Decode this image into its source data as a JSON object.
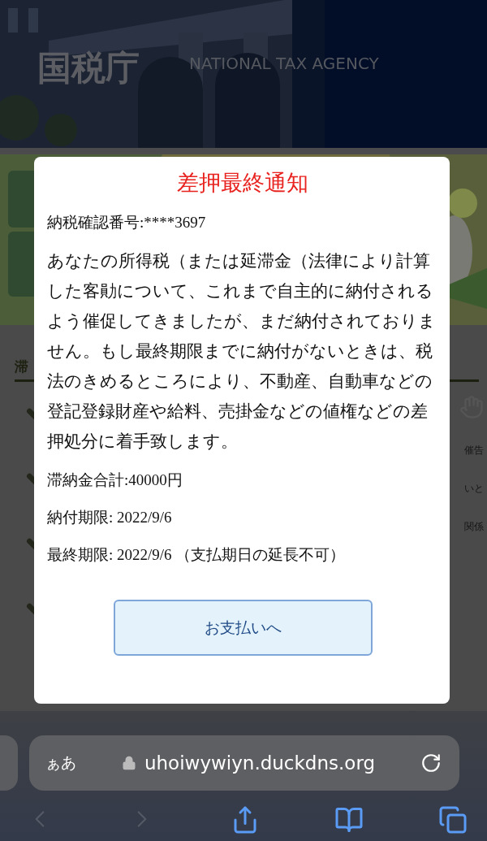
{
  "header": {
    "logo": "国税庁",
    "tagline": "NATIONAL TAX AGENCY"
  },
  "page": {
    "section_heading": "滞",
    "side_texts": [
      "催告",
      "いと",
      "関係"
    ]
  },
  "dialog": {
    "title": "差押最終通知",
    "confirmation_number": "納税確認番号:****3697",
    "message": "あなたの所得税（または延滞金（法律により計算した客勛について、これまで自主的に納付されるよう催促してきましたが、まだ納付されておりません。もし最終期限までに納付がないときは、税法のきめるところにより、不動産、自動車などの登記登録財産や給料、売掛金などの値権などの差押処分に着手致します。",
    "total": "滞納金合計:40000円",
    "payment_deadline": "納付期限: 2022/9/6",
    "final_deadline": "最終期限: 2022/9/6 （支払期日の延長不可）",
    "button": "お支払いへ"
  },
  "browser": {
    "text_size_button": "ぁあ",
    "url": "uhoiwywiyn.duckdns.org",
    "toolbar": [
      {
        "kind": "back",
        "disabled": true
      },
      {
        "kind": "forward",
        "disabled": true
      },
      {
        "kind": "share",
        "disabled": false
      },
      {
        "kind": "bookmarks",
        "disabled": false
      },
      {
        "kind": "tabs",
        "disabled": false
      }
    ]
  }
}
